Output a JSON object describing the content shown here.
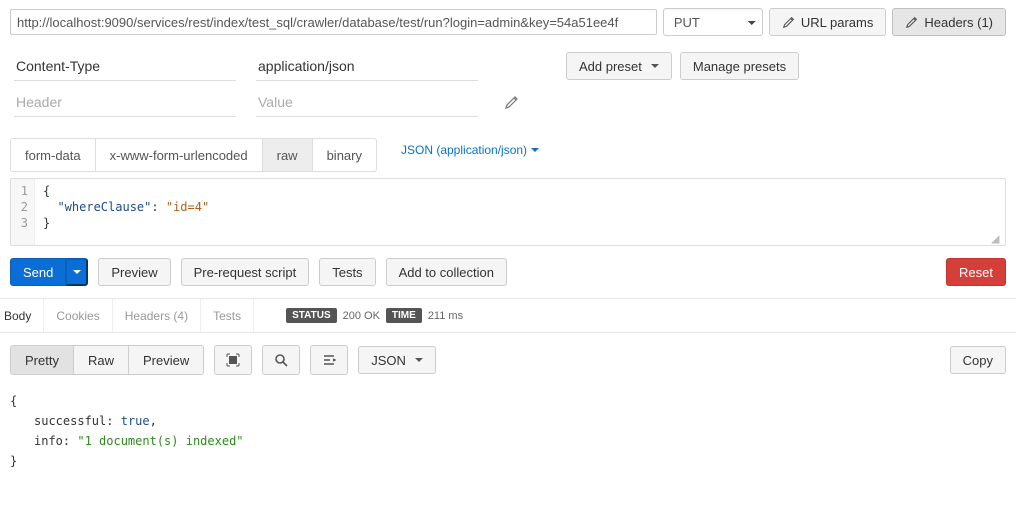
{
  "top": {
    "url": "http://localhost:9090/services/rest/index/test_sql/crawler/database/test/run?login=admin&key=54a51ee4f",
    "method": "PUT",
    "url_params_btn": "URL params",
    "headers_btn": "Headers (1)"
  },
  "headers": {
    "rows": [
      {
        "key": "Content-Type",
        "value": "application/json"
      },
      {
        "key": "",
        "value": ""
      }
    ],
    "placeholder_key": "Header",
    "placeholder_value": "Value",
    "add_preset": "Add preset",
    "manage_presets": "Manage presets"
  },
  "body_tabs": {
    "items": [
      "form-data",
      "x-www-form-urlencoded",
      "raw",
      "binary"
    ],
    "active": "raw",
    "json_label": "JSON (application/json)"
  },
  "editor": {
    "l1": "{",
    "l2_key": "\"whereClause\"",
    "l2_sep": ": ",
    "l2_val": "\"id=4\"",
    "l3": "}"
  },
  "actions": {
    "send": "Send",
    "preview": "Preview",
    "prerequest": "Pre-request script",
    "tests": "Tests",
    "add_collection": "Add to collection",
    "reset": "Reset"
  },
  "resp_tabs": {
    "items": [
      "Body",
      "Cookies",
      "Headers (4)",
      "Tests"
    ],
    "status_label": "STATUS",
    "status_value": "200 OK",
    "time_label": "TIME",
    "time_value": "211 ms"
  },
  "resp_bar": {
    "views": [
      "Pretty",
      "Raw",
      "Preview"
    ],
    "active": "Pretty",
    "format": "JSON",
    "copy": "Copy"
  },
  "response": {
    "open": "{",
    "k1": "successful:",
    "v1": "true",
    "k2": "info:",
    "v2": "\"1 document(s) indexed\"",
    "close": "}"
  }
}
